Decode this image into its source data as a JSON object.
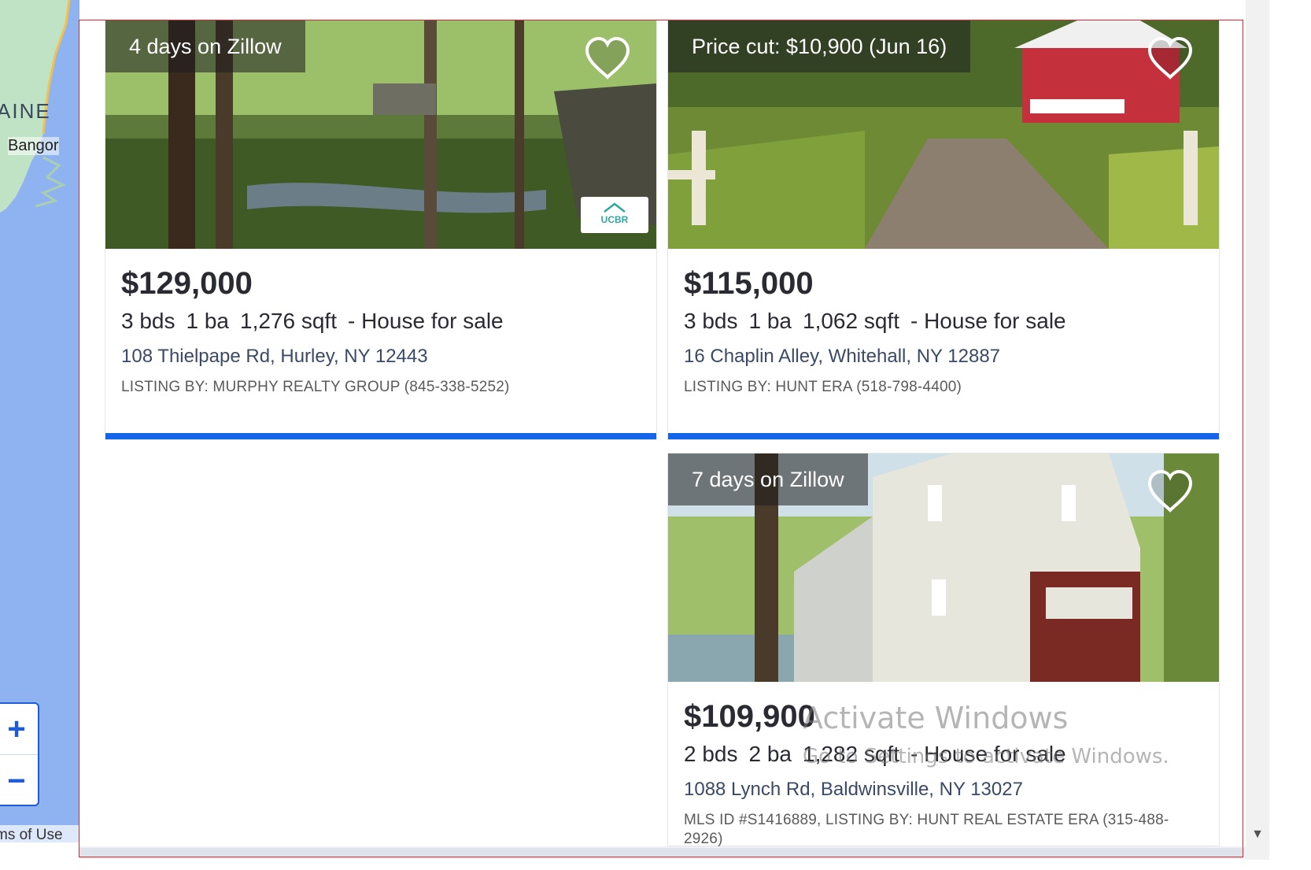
{
  "map": {
    "state_label": "AINE",
    "city_label": "Bangor",
    "zoom_in": "+",
    "zoom_out": "−",
    "terms": "ms of Use"
  },
  "listings": [
    {
      "badge": "4 days on Zillow",
      "price": "$129,000",
      "beds": "3 bds",
      "baths": "1 ba",
      "sqft": "1,276 sqft",
      "type": "- House for sale",
      "address": "108 Thielpape Rd, Hurley, NY 12443",
      "broker": "LISTING BY: MURPHY REALTY GROUP (845-338-5252)",
      "logo_text": "UCBR"
    },
    {
      "badge": "Price cut: $10,900 (Jun 16)",
      "price": "$115,000",
      "beds": "3 bds",
      "baths": "1 ba",
      "sqft": "1,062 sqft",
      "type": "- House for sale",
      "address": "16 Chaplin Alley, Whitehall, NY 12887",
      "broker": "LISTING BY: HUNT ERA (518-798-4400)"
    },
    {
      "badge": "7 days on Zillow",
      "price": "$109,900",
      "beds": "2 bds",
      "baths": "2 ba",
      "sqft": "1,282 sqft",
      "type": "- House for sale",
      "address": "1088 Lynch Rd, Baldwinsville, NY 13027",
      "broker": "MLS ID #S1416889, LISTING BY: HUNT REAL ESTATE ERA (315-488-2926)"
    }
  ],
  "watermark": {
    "title": "Activate Windows",
    "subtitle": "Go to Settings to activate Windows."
  },
  "colors": {
    "accent": "#1565e8",
    "map_water": "#8fb3f0",
    "frame": "#e0262e"
  }
}
